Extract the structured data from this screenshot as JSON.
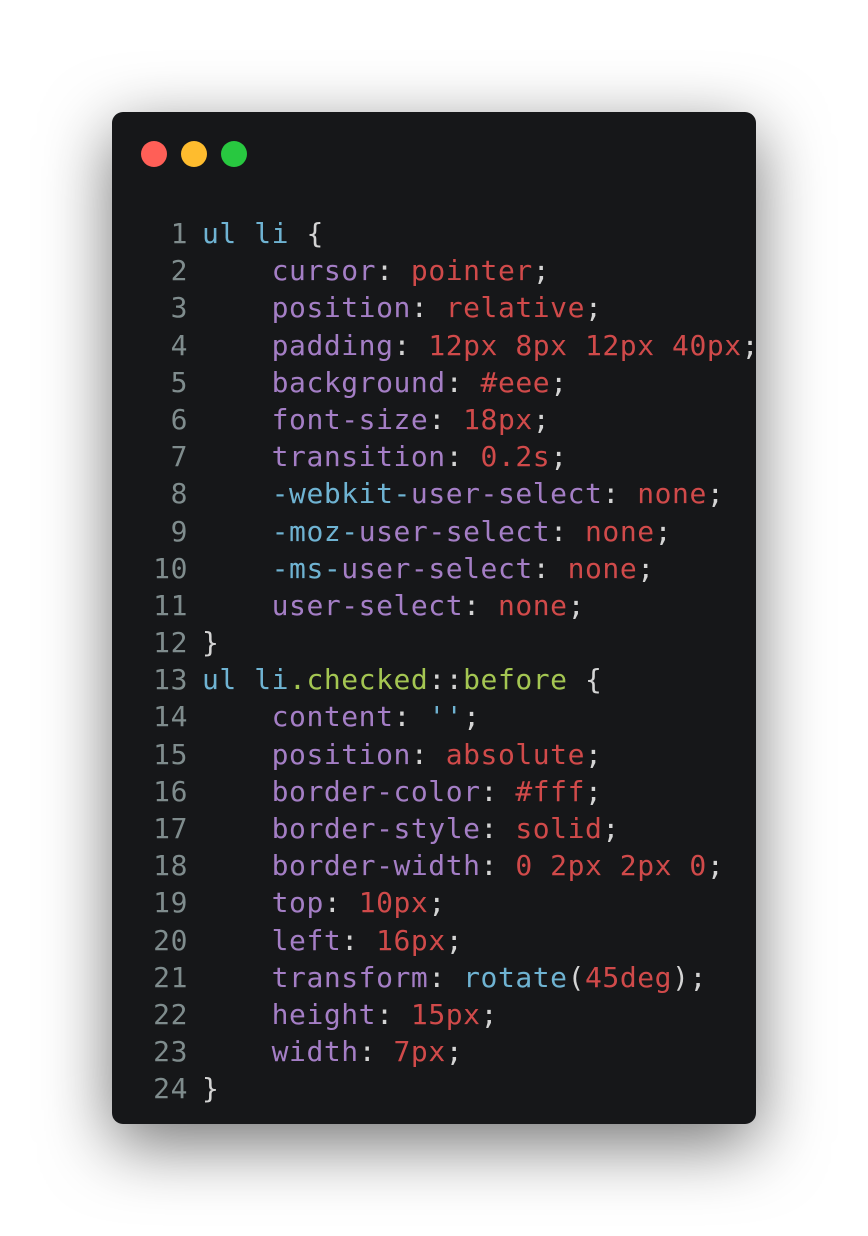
{
  "window": {
    "traffic_lights": [
      {
        "name": "close",
        "color": "#ff5f57"
      },
      {
        "name": "minimize",
        "color": "#febc2e"
      },
      {
        "name": "maximize",
        "color": "#28c840"
      }
    ],
    "background": "#161719"
  },
  "colors": {
    "selector": "#6fb3d2",
    "pseudo": "#a4c652",
    "property": "#a47ec5",
    "value": "#d04a4a",
    "punctuation": "#d4d4d4",
    "line_number": "#7f8c8d"
  },
  "code": {
    "lines": [
      {
        "n": "1",
        "tokens": [
          [
            "sel",
            "ul li"
          ],
          [
            "punc",
            " {"
          ]
        ]
      },
      {
        "n": "2",
        "tokens": [
          [
            "punc",
            "    "
          ],
          [
            "prop",
            "cursor"
          ],
          [
            "punc",
            ": "
          ],
          [
            "val",
            "pointer"
          ],
          [
            "punc",
            ";"
          ]
        ]
      },
      {
        "n": "3",
        "tokens": [
          [
            "punc",
            "    "
          ],
          [
            "prop",
            "position"
          ],
          [
            "punc",
            ": "
          ],
          [
            "val",
            "relative"
          ],
          [
            "punc",
            ";"
          ]
        ]
      },
      {
        "n": "4",
        "tokens": [
          [
            "punc",
            "    "
          ],
          [
            "prop",
            "padding"
          ],
          [
            "punc",
            ": "
          ],
          [
            "val",
            "12px 8px 12px 40px"
          ],
          [
            "punc",
            ";"
          ]
        ]
      },
      {
        "n": "5",
        "tokens": [
          [
            "punc",
            "    "
          ],
          [
            "prop",
            "background"
          ],
          [
            "punc",
            ": "
          ],
          [
            "val",
            "#eee"
          ],
          [
            "punc",
            ";"
          ]
        ]
      },
      {
        "n": "6",
        "tokens": [
          [
            "punc",
            "    "
          ],
          [
            "prop",
            "font-size"
          ],
          [
            "punc",
            ": "
          ],
          [
            "val",
            "18px"
          ],
          [
            "punc",
            ";"
          ]
        ]
      },
      {
        "n": "7",
        "tokens": [
          [
            "punc",
            "    "
          ],
          [
            "prop",
            "transition"
          ],
          [
            "punc",
            ": "
          ],
          [
            "val",
            "0.2s"
          ],
          [
            "punc",
            ";"
          ]
        ]
      },
      {
        "n": "8",
        "tokens": [
          [
            "punc",
            "    "
          ],
          [
            "vendor",
            "-webkit-"
          ],
          [
            "prop",
            "user-select"
          ],
          [
            "punc",
            ": "
          ],
          [
            "val",
            "none"
          ],
          [
            "punc",
            ";"
          ]
        ]
      },
      {
        "n": "9",
        "tokens": [
          [
            "punc",
            "    "
          ],
          [
            "vendor",
            "-moz-"
          ],
          [
            "prop",
            "user-select"
          ],
          [
            "punc",
            ": "
          ],
          [
            "val",
            "none"
          ],
          [
            "punc",
            ";"
          ]
        ]
      },
      {
        "n": "10",
        "tokens": [
          [
            "punc",
            "    "
          ],
          [
            "vendor",
            "-ms-"
          ],
          [
            "prop",
            "user-select"
          ],
          [
            "punc",
            ": "
          ],
          [
            "val",
            "none"
          ],
          [
            "punc",
            ";"
          ]
        ]
      },
      {
        "n": "11",
        "tokens": [
          [
            "punc",
            "    "
          ],
          [
            "prop",
            "user-select"
          ],
          [
            "punc",
            ": "
          ],
          [
            "val",
            "none"
          ],
          [
            "punc",
            ";"
          ]
        ]
      },
      {
        "n": "12",
        "tokens": [
          [
            "punc",
            "}"
          ]
        ]
      },
      {
        "n": "13",
        "tokens": [
          [
            "sel",
            "ul li"
          ],
          [
            "pseudo",
            ".checked"
          ],
          [
            "punc",
            "::"
          ],
          [
            "pseudo",
            "before"
          ],
          [
            "punc",
            " {"
          ]
        ]
      },
      {
        "n": "14",
        "tokens": [
          [
            "punc",
            "    "
          ],
          [
            "prop",
            "content"
          ],
          [
            "punc",
            ": "
          ],
          [
            "str",
            "''"
          ],
          [
            "punc",
            ";"
          ]
        ]
      },
      {
        "n": "15",
        "tokens": [
          [
            "punc",
            "    "
          ],
          [
            "prop",
            "position"
          ],
          [
            "punc",
            ": "
          ],
          [
            "val",
            "absolute"
          ],
          [
            "punc",
            ";"
          ]
        ]
      },
      {
        "n": "16",
        "tokens": [
          [
            "punc",
            "    "
          ],
          [
            "prop",
            "border-color"
          ],
          [
            "punc",
            ": "
          ],
          [
            "val",
            "#fff"
          ],
          [
            "punc",
            ";"
          ]
        ]
      },
      {
        "n": "17",
        "tokens": [
          [
            "punc",
            "    "
          ],
          [
            "prop",
            "border-style"
          ],
          [
            "punc",
            ": "
          ],
          [
            "val",
            "solid"
          ],
          [
            "punc",
            ";"
          ]
        ]
      },
      {
        "n": "18",
        "tokens": [
          [
            "punc",
            "    "
          ],
          [
            "prop",
            "border-width"
          ],
          [
            "punc",
            ": "
          ],
          [
            "val",
            "0 2px 2px 0"
          ],
          [
            "punc",
            ";"
          ]
        ]
      },
      {
        "n": "19",
        "tokens": [
          [
            "punc",
            "    "
          ],
          [
            "prop",
            "top"
          ],
          [
            "punc",
            ": "
          ],
          [
            "val",
            "10px"
          ],
          [
            "punc",
            ";"
          ]
        ]
      },
      {
        "n": "20",
        "tokens": [
          [
            "punc",
            "    "
          ],
          [
            "prop",
            "left"
          ],
          [
            "punc",
            ": "
          ],
          [
            "val",
            "16px"
          ],
          [
            "punc",
            ";"
          ]
        ]
      },
      {
        "n": "21",
        "tokens": [
          [
            "punc",
            "    "
          ],
          [
            "prop",
            "transform"
          ],
          [
            "punc",
            ": "
          ],
          [
            "func",
            "rotate"
          ],
          [
            "punc",
            "("
          ],
          [
            "val",
            "45deg"
          ],
          [
            "punc",
            ");"
          ]
        ]
      },
      {
        "n": "22",
        "tokens": [
          [
            "punc",
            "    "
          ],
          [
            "prop",
            "height"
          ],
          [
            "punc",
            ": "
          ],
          [
            "val",
            "15px"
          ],
          [
            "punc",
            ";"
          ]
        ]
      },
      {
        "n": "23",
        "tokens": [
          [
            "punc",
            "    "
          ],
          [
            "prop",
            "width"
          ],
          [
            "punc",
            ": "
          ],
          [
            "val",
            "7px"
          ],
          [
            "punc",
            ";"
          ]
        ]
      },
      {
        "n": "24",
        "tokens": [
          [
            "punc",
            "}"
          ]
        ]
      }
    ]
  }
}
